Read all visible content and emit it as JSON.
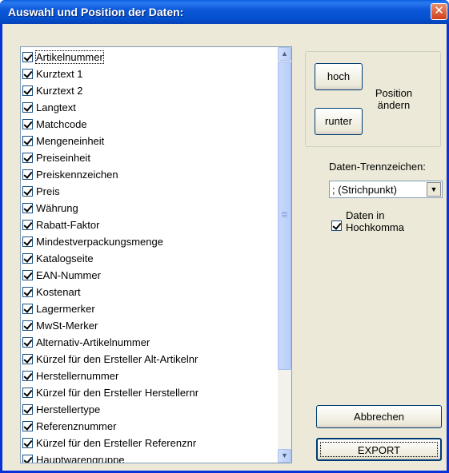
{
  "window": {
    "title": "Auswahl und Position der Daten:",
    "close_symbol": "✕"
  },
  "list": {
    "items": [
      {
        "label": "Artikelnummer",
        "checked": true,
        "selected": true
      },
      {
        "label": "Kurztext 1",
        "checked": true
      },
      {
        "label": "Kurztext 2",
        "checked": true
      },
      {
        "label": "Langtext",
        "checked": true
      },
      {
        "label": "Matchcode",
        "checked": true
      },
      {
        "label": "Mengeneinheit",
        "checked": true
      },
      {
        "label": "Preiseinheit",
        "checked": true
      },
      {
        "label": "Preiskennzeichen",
        "checked": true
      },
      {
        "label": "Preis",
        "checked": true
      },
      {
        "label": "Währung",
        "checked": true
      },
      {
        "label": "Rabatt-Faktor",
        "checked": true
      },
      {
        "label": "Mindestverpackungsmenge",
        "checked": true
      },
      {
        "label": "Katalogseite",
        "checked": true
      },
      {
        "label": "EAN-Nummer",
        "checked": true
      },
      {
        "label": "Kostenart",
        "checked": true
      },
      {
        "label": "Lagermerker",
        "checked": true
      },
      {
        "label": "MwSt-Merker",
        "checked": true
      },
      {
        "label": "Alternativ-Artikelnummer",
        "checked": true
      },
      {
        "label": "Kürzel für den Ersteller Alt-Artikelnr",
        "checked": true
      },
      {
        "label": "Herstellernummer",
        "checked": true
      },
      {
        "label": "Kürzel für den Ersteller Herstellernr",
        "checked": true
      },
      {
        "label": "Herstellertype",
        "checked": true
      },
      {
        "label": "Referenznummer",
        "checked": true
      },
      {
        "label": "Kürzel für den Ersteller Referenznr",
        "checked": true
      },
      {
        "label": "Hauptwarengruppe",
        "checked": true
      }
    ]
  },
  "position": {
    "up_label": "hoch",
    "down_label": "runter",
    "change_label_line1": "Position",
    "change_label_line2": "ändern"
  },
  "separator": {
    "label": "Daten-Trennzeichen:",
    "selected": "; (Strichpunkt)"
  },
  "quote_option": {
    "line1": "Daten in",
    "line2": "Hochkomma",
    "checked": true
  },
  "buttons": {
    "cancel_label": "Abbrechen",
    "export_label": "EXPORT"
  },
  "icons": {
    "scroll_up": "▲",
    "scroll_down": "▼",
    "dropdown": "▼"
  }
}
